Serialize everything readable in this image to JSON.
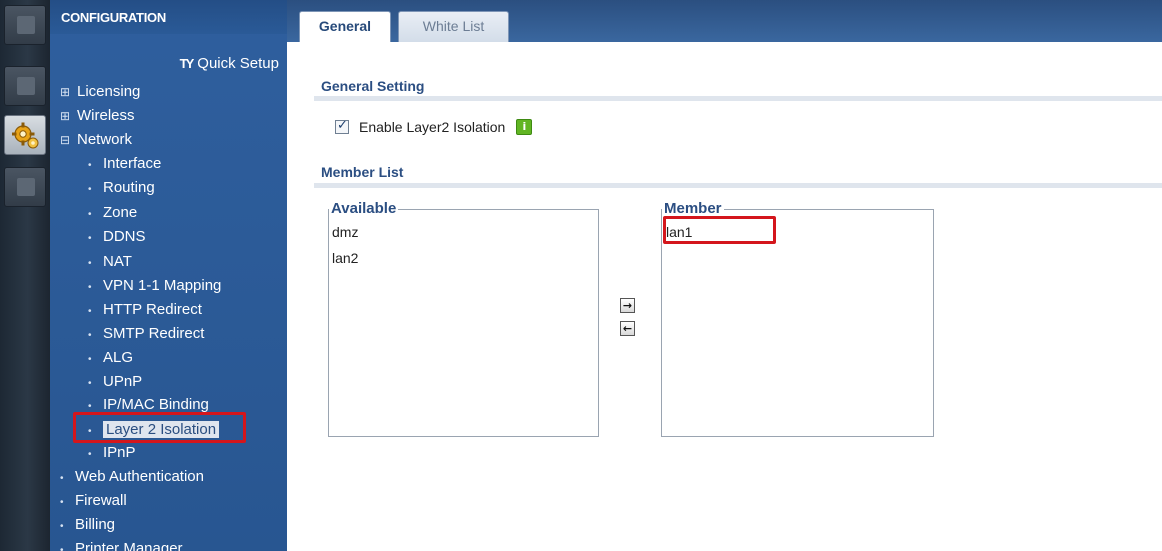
{
  "icon_bar": {
    "items": [
      {
        "icon": "dashboard-icon",
        "active": false
      },
      {
        "icon": "monitor-icon",
        "active": false
      },
      {
        "icon": "configuration-gear-icon",
        "active": true
      },
      {
        "icon": "maintenance-icon",
        "active": false
      }
    ]
  },
  "nav": {
    "title": "CONFIGURATION",
    "quick_setup": "Quick Setup",
    "items": [
      {
        "label": "Licensing",
        "marker": "⊞"
      },
      {
        "label": "Wireless",
        "marker": "⊞"
      },
      {
        "label": "Network",
        "marker": "⊟"
      },
      {
        "label": "Interface",
        "marker": "•"
      },
      {
        "label": "Routing",
        "marker": "•"
      },
      {
        "label": "Zone",
        "marker": "•"
      },
      {
        "label": "DDNS",
        "marker": "•"
      },
      {
        "label": "NAT",
        "marker": "•"
      },
      {
        "label": "VPN 1-1 Mapping",
        "marker": "•"
      },
      {
        "label": "HTTP Redirect",
        "marker": "•"
      },
      {
        "label": "SMTP Redirect",
        "marker": "•"
      },
      {
        "label": "ALG",
        "marker": "•"
      },
      {
        "label": "UPnP",
        "marker": "•"
      },
      {
        "label": "IP/MAC Binding",
        "marker": "•"
      },
      {
        "label": "Layer 2 Isolation",
        "marker": "•"
      },
      {
        "label": "IPnP",
        "marker": "•"
      },
      {
        "label": "Web Authentication",
        "marker": "•"
      },
      {
        "label": "Firewall",
        "marker": "•"
      },
      {
        "label": "Billing",
        "marker": "•"
      },
      {
        "label": "Printer Manager",
        "marker": "•"
      }
    ]
  },
  "tabs": [
    {
      "label": "General",
      "active": true
    },
    {
      "label": "White List",
      "active": false
    }
  ],
  "general_setting": {
    "title": "General Setting",
    "enable_label": "Enable Layer2 Isolation",
    "enable_checked": true,
    "info_icon": "i"
  },
  "member_list": {
    "title": "Member List",
    "available_label": "Available",
    "available_items": [
      "dmz",
      "lan2"
    ],
    "member_label": "Member",
    "member_items": [
      "lan1"
    ],
    "add_button": "→",
    "remove_button": "←"
  },
  "colors": {
    "nav_bg": "#2f5f9e",
    "tab_bar_bg": "#2b4f80",
    "section_title": "#2b4e82",
    "highlight": "#d4161c"
  }
}
